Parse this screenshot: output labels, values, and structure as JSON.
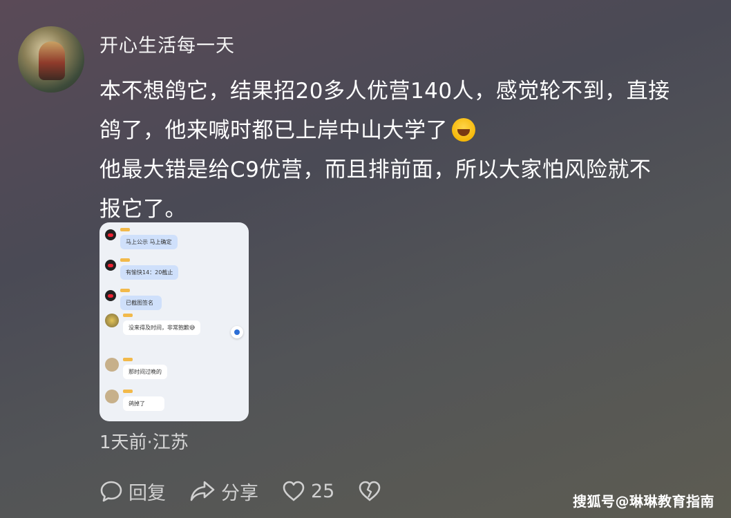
{
  "post": {
    "username": "开心生活每一天",
    "comment_lines": [
      "本不想鸽它，结果招20多人优营140人，感觉轮不到，直接",
      "鸽了，他来喊时都已上岸中山大学了",
      "他最大错是给C9优营，而且排前面，所以大家怕风险就不",
      "报它了。"
    ],
    "emoji": "laughing-crying-emoji",
    "time_location": "1天前·江苏"
  },
  "chat_screenshot": {
    "messages": [
      {
        "side": "left",
        "avatar": "qq-penguin",
        "bubble": "blue",
        "text": "马上公示 马上确定"
      },
      {
        "side": "left",
        "avatar": "qq-penguin",
        "bubble": "blue",
        "text": "有愉快14：20截止"
      },
      {
        "side": "left",
        "avatar": "qq-penguin",
        "bubble": "blue",
        "text": "已截图签名"
      },
      {
        "side": "left",
        "avatar": "gold-avatar",
        "bubble": "white",
        "text": "没来得及时间，非常抱歉😅"
      },
      {
        "side": "left",
        "avatar": "beige-avatar",
        "bubble": "white",
        "text": "那时间过晚的"
      },
      {
        "side": "left",
        "avatar": "beige-avatar",
        "bubble": "white",
        "text": "鸽掉了"
      }
    ]
  },
  "actions": {
    "reply_label": "回复",
    "share_label": "分享",
    "like_count": "25"
  },
  "watermark": "搜狐号@琳琳教育指南"
}
